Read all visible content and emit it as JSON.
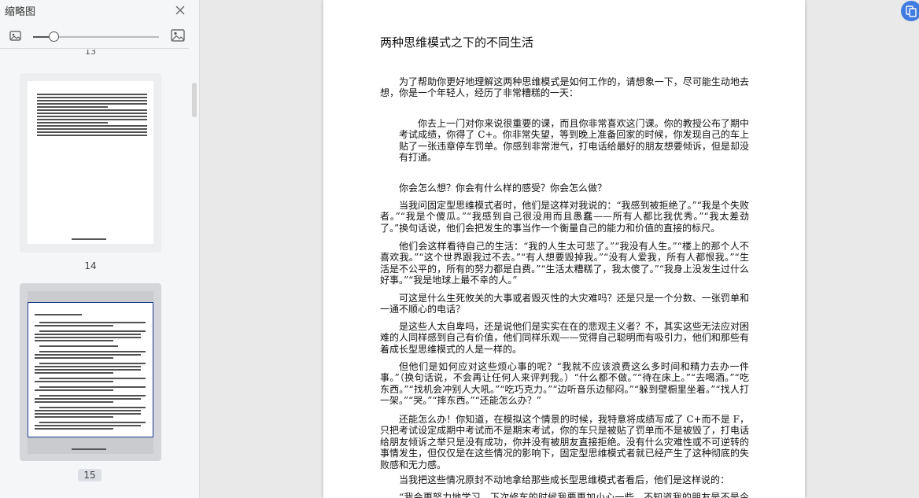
{
  "sidebar": {
    "title": "缩略图",
    "zoom_level": 0.16,
    "prev_page_number": "13",
    "thumbnails": [
      {
        "page": "14",
        "selected": false
      },
      {
        "page": "15",
        "selected": true
      }
    ]
  },
  "icons": {
    "close": "close-icon",
    "small_image": "image-small-icon",
    "large_image": "image-large-icon",
    "float": "translate-icon"
  },
  "colors": {
    "accent": "#3f7be0",
    "selected_border": "#1a3b8f"
  },
  "document": {
    "title": "两种思维模式之下的不同生活",
    "paragraphs": [
      "为了帮助你更好地理解这两种思维模式是如何工作的，请想象一下，尽可能生动地去想，你是一个年轻人，经历了非常糟糕的一天：",
      "你去上一门对你来说很重要的课，而且你非常喜欢这门课。你的教授公布了期中考试成绩，你得了 C+。你非常失望，等到晚上准备回家的时候，你发现自己的车上贴了一张违章停车罚单。你感到非常泄气，打电话给最好的朋友想要倾诉，但是却没有打通。",
      "你会怎么想？你会有什么样的感受？你会怎么做？",
      "当我问固定型思维模式者时，他们是这样对我说的：“我感到被拒绝了。”“我是个失败者。”“我是个傻瓜。”“我感到自己很没用而且愚蠢——所有人都比我优秀。”“我太差劲了。”换句话说，他们会把发生的事当作一个衡量自己的能力和价值的直接的标尺。",
      "他们会这样看待自己的生活：“我的人生太可悲了。”“我没有人生。”“楼上的那个人不喜欢我。”“这个世界跟我过不去。”“有人想要毁掉我。”“没有人爱我，所有人都恨我。”“生活是不公平的，所有的努力都是白费。”“生活太糟糕了，我太傻了。”“我身上没发生过什么好事。”“我是地球上最不幸的人。”",
      "可这是什么生死攸关的大事或者毁灭性的大灾难吗？还是只是一个分数、一张罚单和一通不顺心的电话？",
      "是这些人太自卑吗，还是说他们是实实在在的悲观主义者？不，其实这些无法应对困难的人同样感到自己有价值，他们同样乐观——觉得自己聪明而有吸引力，他们和那些有着成长型思维模式的人是一样的。",
      "但他们是如何应对这些烦心事的呢？“我就不应该浪费这么多时间和精力去办一件事。”（换句话说，不会再让任何人来评判我。）“什么都不做。”“待在床上。”“去喝酒。”“吃东西。”“找机会冲别人大吼。”“吃巧克力。”“边听音乐边郁闷。”“躲到壁橱里坐着。”“找人打一架。”“哭。”“摔东西。”“还能怎么办？”",
      "还能怎么办！你知道，在模拟这个情景的时候，我特意将成绩写成了 C+而不是 F，只把考试设定成期中考试而不是期末考试，你的车只是被贴了罚单而不是被毁了，打电话给朋友倾诉之举只是没有成功，你并没有被朋友直接拒绝。没有什么灾难性或不可逆转的事情发生，但仅仅是在这些情况的影响下，固定型思维模式者就已经产生了这种彻底的失败感和无力感。",
      "当我把这些情况原封不动地拿给那些成长型思维模式者看后，他们是这样说的：",
      "“我会更努力地学习，下次修车的时候我要更加小心一些，不知道我的朋友是不是今天过得也不太顺利。”"
    ]
  }
}
